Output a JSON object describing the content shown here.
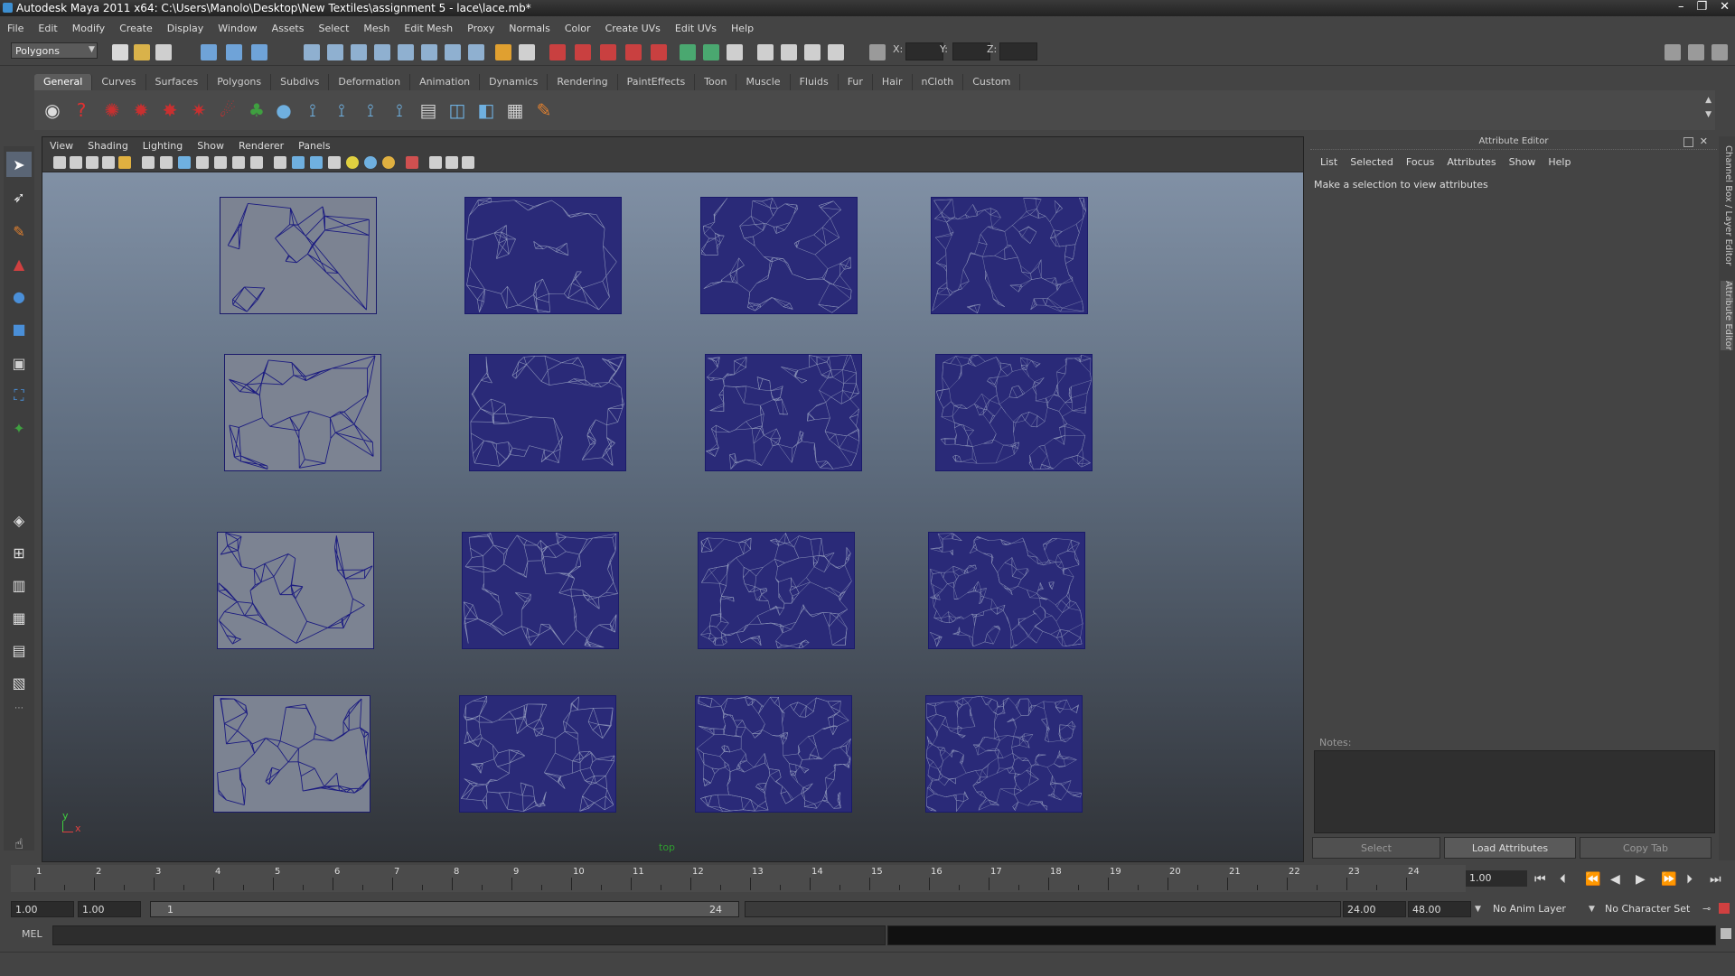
{
  "window": {
    "title": "Autodesk Maya 2011 x64: C:\\Users\\Manolo\\Desktop\\New Textiles\\assignment 5 - lace\\lace.mb*",
    "controls": [
      "–",
      "❐",
      "✕"
    ]
  },
  "menubar": [
    "File",
    "Edit",
    "Modify",
    "Create",
    "Display",
    "Window",
    "Assets",
    "Select",
    "Mesh",
    "Edit Mesh",
    "Proxy",
    "Normals",
    "Color",
    "Create UVs",
    "Edit UVs",
    "Help"
  ],
  "statusline": {
    "mode": "Polygons",
    "x_label": "X:",
    "y_label": "Y:",
    "z_label": "Z:"
  },
  "shelf": {
    "tabs": [
      "General",
      "Curves",
      "Surfaces",
      "Polygons",
      "Subdivs",
      "Deformation",
      "Animation",
      "Dynamics",
      "Rendering",
      "PaintEffects",
      "Toon",
      "Muscle",
      "Fluids",
      "Fur",
      "Hair",
      "nCloth",
      "Custom"
    ],
    "active_tab": "General"
  },
  "viewport": {
    "menu": [
      "View",
      "Shading",
      "Lighting",
      "Show",
      "Renderer",
      "Panels"
    ],
    "camera_label": "top",
    "axis_y": "y",
    "axis_x": "x",
    "mesh_color": "#1b1b80",
    "bg_top": "#8595aa",
    "bg_bottom": "#303338",
    "density_rows": [
      1,
      2,
      3,
      4
    ]
  },
  "attribute_editor": {
    "header": "Attribute Editor",
    "menu": [
      "List",
      "Selected",
      "Focus",
      "Attributes",
      "Show",
      "Help"
    ],
    "message": "Make a selection to view attributes",
    "notes_label": "Notes:",
    "buttons": {
      "select": "Select",
      "load": "Load Attributes",
      "copy": "Copy Tab"
    }
  },
  "side_tabs": [
    "Channel Box / Layer Editor",
    "Attribute Editor"
  ],
  "timeline": {
    "frames": [
      "1",
      "2",
      "3",
      "4",
      "5",
      "6",
      "7",
      "8",
      "9",
      "10",
      "11",
      "12",
      "13",
      "14",
      "15",
      "16",
      "17",
      "18",
      "19",
      "20",
      "21",
      "22",
      "23",
      "24"
    ],
    "current_frame": "1.00"
  },
  "range": {
    "start": "1.00",
    "anim_start": "1.00",
    "slider_start": "1",
    "slider_end": "24",
    "end": "24.00",
    "anim_end": "48.00",
    "anim_layer": "No Anim Layer",
    "char_set": "No Character Set"
  },
  "command": {
    "label": "MEL"
  }
}
